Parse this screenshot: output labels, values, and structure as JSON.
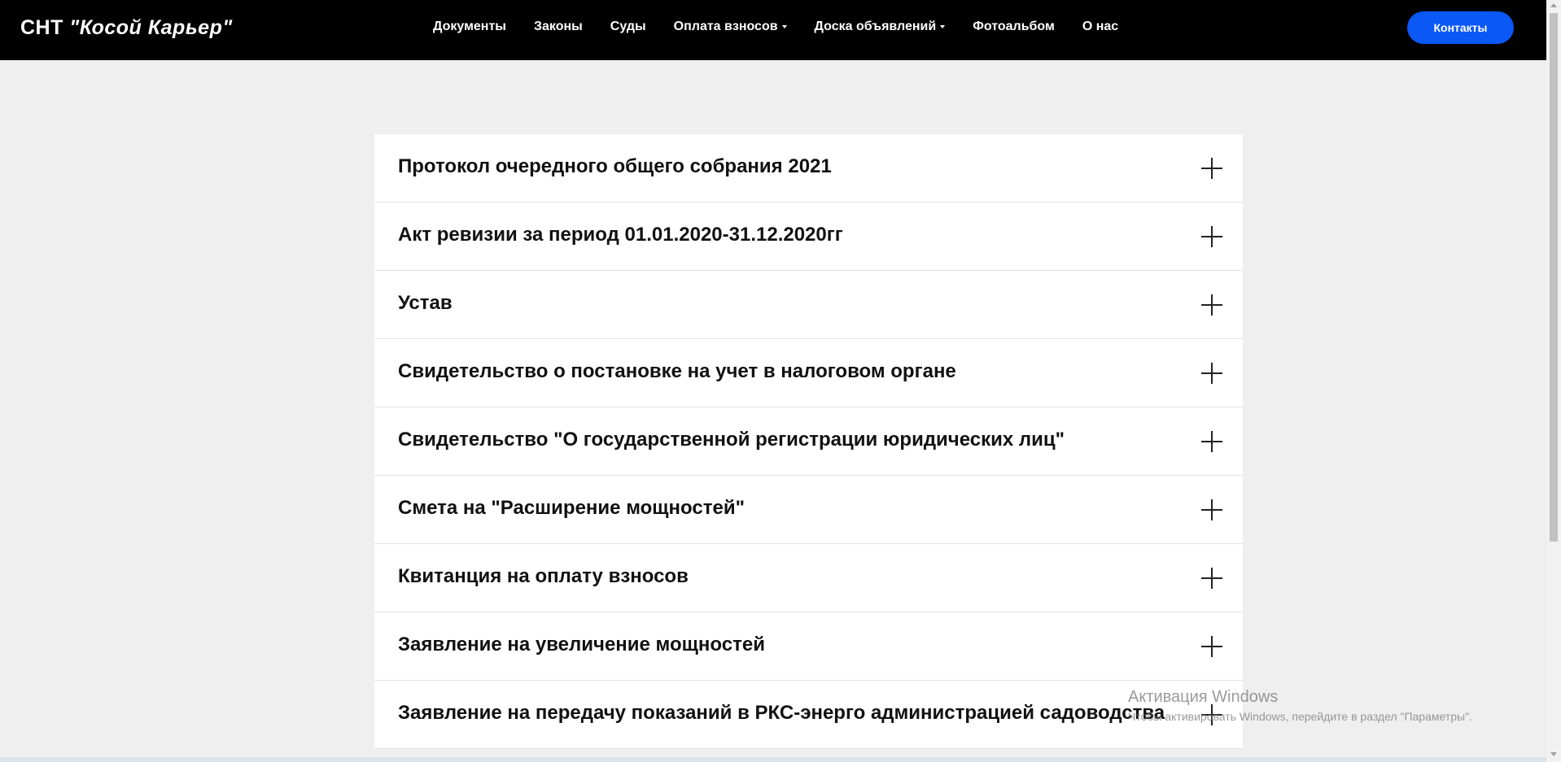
{
  "header": {
    "logo_prefix": "СНТ",
    "logo_name": "\"Косой Карьер\"",
    "nav": [
      {
        "label": "Документы",
        "dropdown": false
      },
      {
        "label": "Законы",
        "dropdown": false
      },
      {
        "label": "Суды",
        "dropdown": false
      },
      {
        "label": "Оплата взносов",
        "dropdown": true
      },
      {
        "label": "Доска объявлений",
        "dropdown": true
      },
      {
        "label": "Фотоальбом",
        "dropdown": false
      },
      {
        "label": "О нас",
        "dropdown": false
      }
    ],
    "contact_label": "Контакты",
    "accent_color": "#0a58f5"
  },
  "accordion": {
    "items": [
      {
        "title": "Протокол очередного общего собрания 2021",
        "icon": "plus-icon"
      },
      {
        "title": "Акт ревизии за период 01.01.2020-31.12.2020гг",
        "icon": "plus-icon"
      },
      {
        "title": "Устав",
        "icon": "plus-icon"
      },
      {
        "title": "Свидетельство о постановке на учет в налоговом органе",
        "icon": "plus-icon"
      },
      {
        "title": "Свидетельство \"О государственной регистрации юридических лиц\"",
        "icon": "plus-icon"
      },
      {
        "title": "Смета на \"Расширение мощностей\"",
        "icon": "plus-icon"
      },
      {
        "title": "Квитанция на оплату взносов",
        "icon": "plus-icon"
      },
      {
        "title": "Заявление на увеличение мощностей",
        "icon": "plus-icon"
      },
      {
        "title": "Заявление на передачу показаний в РКС-энерго администрацией садоводства",
        "icon": "plus-icon"
      }
    ]
  },
  "watermark": {
    "line1": "Активация Windows",
    "line2": "Чтобы активировать Windows, перейдите в раздел \"Параметры\"."
  }
}
